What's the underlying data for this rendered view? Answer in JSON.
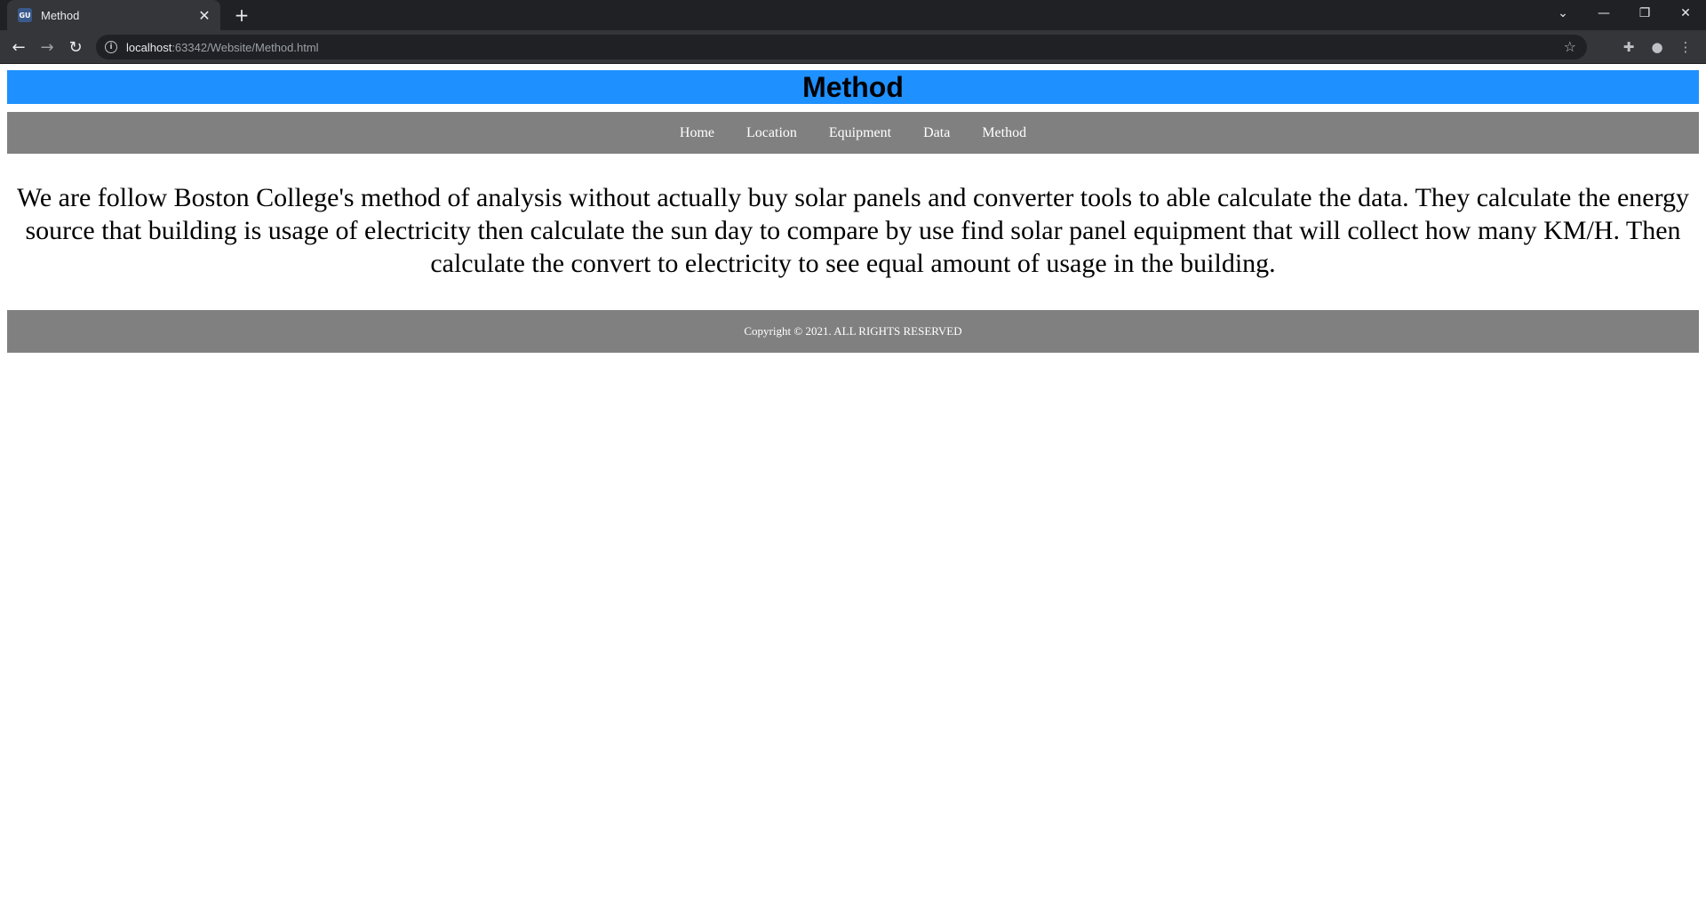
{
  "browser": {
    "tab_title": "Method",
    "tab_favicon_text": "GU",
    "url_host": "localhost",
    "url_rest": ":63342/Website/Method.html"
  },
  "site": {
    "header_title": "Method",
    "nav": [
      "Home",
      "Location",
      "Equipment",
      "Data",
      "Method"
    ],
    "body_text": "We are follow Boston College's method of analysis without actually buy solar panels and converter tools to able calculate the data. They calculate the energy source that building is usage of electricity then calculate the sun day to compare by use find solar panel equipment that will collect how many KM/H. Then calculate the convert to electricity to see equal amount of usage in the building.",
    "footer_text": "Copyright © 2021. ALL RIGHTS RESERVED"
  },
  "colors": {
    "header_bg": "#1e90ff",
    "nav_bg": "#808080",
    "footer_bg": "#808080"
  }
}
